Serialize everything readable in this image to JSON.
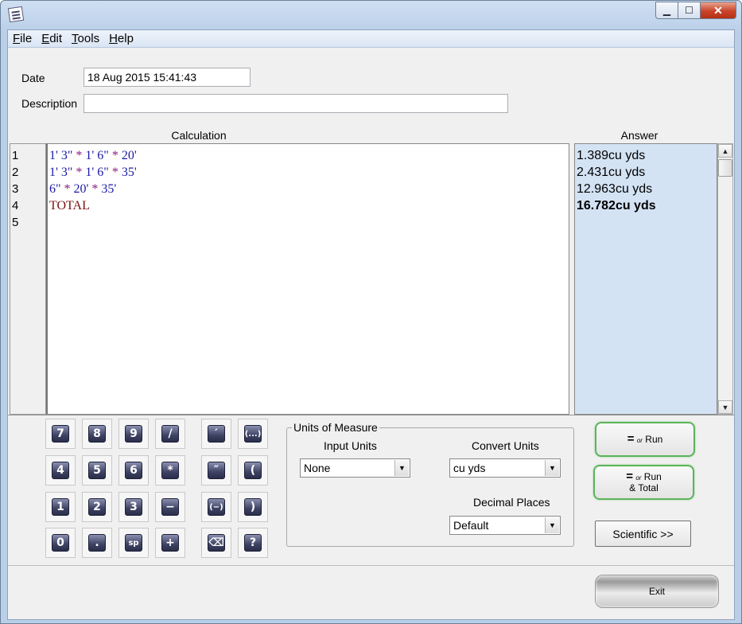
{
  "window": {
    "title": ""
  },
  "menu": [
    {
      "key": "F",
      "rest": "ile"
    },
    {
      "key": "E",
      "rest": "dit"
    },
    {
      "key": "T",
      "rest": "ools"
    },
    {
      "key": "H",
      "rest": "elp"
    }
  ],
  "form": {
    "date_label": "Date",
    "date_value": "18 Aug 2015 15:41:43",
    "description_label": "Description",
    "description_value": ""
  },
  "columns": {
    "calculation": "Calculation",
    "answer": "Answer"
  },
  "lines": [
    "1",
    "2",
    "3",
    "4",
    "5"
  ],
  "calc_rows": [
    [
      {
        "t": "1' 3\" ",
        "c": "expr"
      },
      {
        "t": "* ",
        "c": "op"
      },
      {
        "t": "1' 6\" ",
        "c": "expr"
      },
      {
        "t": "* ",
        "c": "op"
      },
      {
        "t": "20'",
        "c": "expr"
      }
    ],
    [
      {
        "t": "1' 3\" ",
        "c": "expr"
      },
      {
        "t": "* ",
        "c": "op"
      },
      {
        "t": "1' 6\" ",
        "c": "expr"
      },
      {
        "t": "* ",
        "c": "op"
      },
      {
        "t": "35'",
        "c": "expr"
      }
    ],
    [
      {
        "t": "6\" ",
        "c": "expr"
      },
      {
        "t": "* ",
        "c": "op"
      },
      {
        "t": "20' ",
        "c": "expr"
      },
      {
        "t": "* ",
        "c": "op"
      },
      {
        "t": "35'",
        "c": "expr"
      }
    ],
    [
      {
        "t": "TOTAL",
        "c": "kw"
      }
    ],
    []
  ],
  "answers": [
    "1.389cu yds",
    "2.431cu yds",
    "12.963cu yds",
    "16.782cu yds"
  ],
  "keypad": [
    [
      "7",
      "8",
      "9",
      "/",
      "′",
      "(...)"
    ],
    [
      "4",
      "5",
      "6",
      "*",
      "″",
      "("
    ],
    [
      "1",
      "2",
      "3",
      "−",
      "(−)",
      ")"
    ],
    [
      "0",
      ".",
      "sp",
      "+",
      "⌫",
      "?"
    ]
  ],
  "units": {
    "group_title": "Units of Measure",
    "input_label": "Input Units",
    "input_value": "None",
    "convert_label": "Convert Units",
    "convert_value": "cu yds",
    "decimal_label": "Decimal Places",
    "decimal_value": "Default"
  },
  "buttons": {
    "run_eq": "=",
    "run_or": "or",
    "run_label": "Run",
    "run_total_label": "Run",
    "run_total_sub": "& Total",
    "scientific": "Scientific >>",
    "exit": "Exit"
  }
}
